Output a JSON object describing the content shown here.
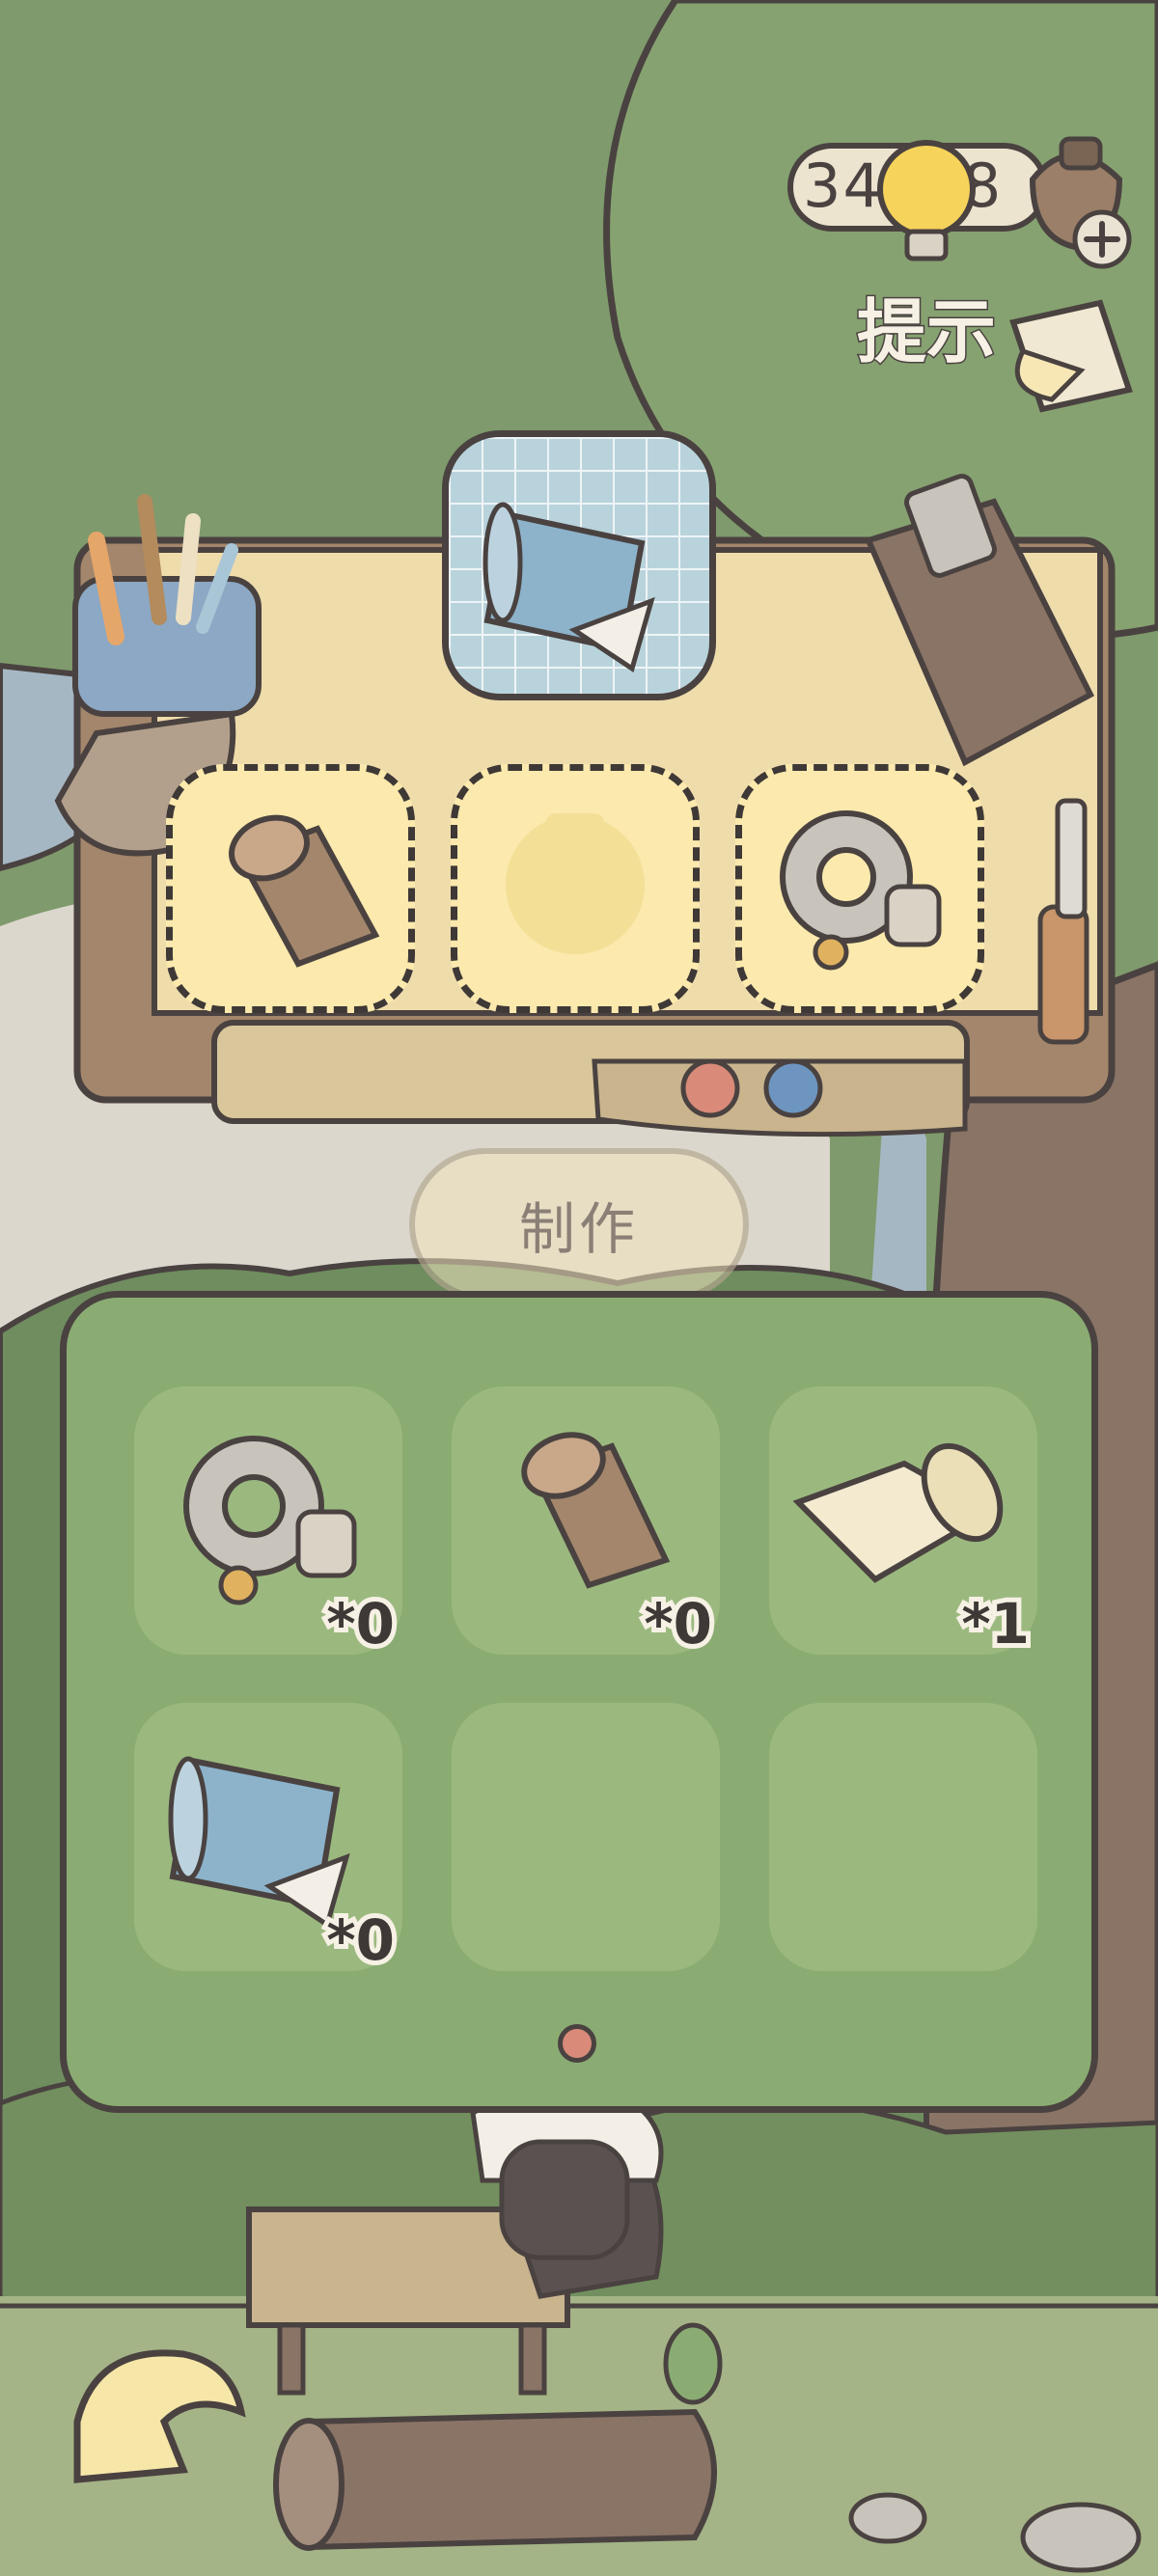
{
  "hud": {
    "resource_count": "34848",
    "hint_label": "提示",
    "bulb_icon": "lightbulb-icon",
    "acorn_icon": "acorn-icon",
    "plus_icon": "plus-icon",
    "hand_icon": "pointing-hand-icon"
  },
  "workbench": {
    "recipe_icon": "blueprint-icon",
    "slots": [
      {
        "item": "wood-log-icon",
        "state": "filled"
      },
      {
        "item": "bag-placeholder-icon",
        "state": "empty"
      },
      {
        "item": "gear-icon",
        "state": "filled"
      }
    ],
    "craft_label": "制作"
  },
  "inventory": {
    "items": [
      {
        "icon": "gear-icon",
        "count": "*0"
      },
      {
        "icon": "wood-log-icon",
        "count": "*0"
      },
      {
        "icon": "paper-scroll-icon",
        "count": "*1"
      },
      {
        "icon": "blueprint-icon",
        "count": "*0"
      },
      {
        "icon": "",
        "count": ""
      },
      {
        "icon": "",
        "count": ""
      }
    ],
    "page_count": 1,
    "current_page": 1
  },
  "colors": {
    "outline": "#4a4240",
    "panel_green": "#8aac73",
    "slot_yellow": "#fbe9ad",
    "table_wood": "#efdcab",
    "page_dot": "#d98a78"
  },
  "back_icon": "back-arrow-icon"
}
